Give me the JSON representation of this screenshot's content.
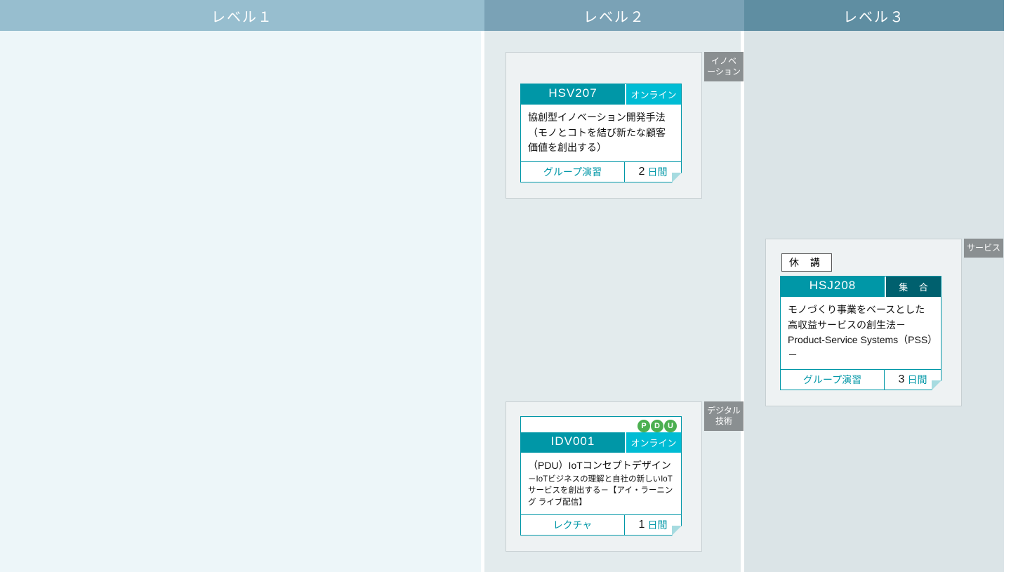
{
  "headers": {
    "l1": "レベル１",
    "l2": "レベル２",
    "l3": "レベル３"
  },
  "duration_unit": "日間",
  "blocks": {
    "innovation": {
      "tag": "イノベーション",
      "code": "HSV207",
      "mode": "オンライン",
      "title": "協創型イノベーション開発手法（モノとコトを結び新たな顧客価値を創出する）",
      "type": "グループ演習",
      "days": "2"
    },
    "digital": {
      "tag": "デジタル技術",
      "pdu": "PDU",
      "code": "IDV001",
      "mode": "オンライン",
      "title_main": "（PDU）IoTコンセプトデザイン",
      "title_sub": "－IoTビジネスの理解と自社の新しいIoTサービスを創出する－【アイ・ラーニング ライブ配信】",
      "type": "レクチャ",
      "days": "1"
    },
    "service": {
      "tag": "サービス",
      "status": "休 講",
      "code": "HSJ208",
      "mode": "集 合",
      "title": "モノづくり事業をベースとした高収益サービスの創生法－Product-Service Systems（PSS）－",
      "type": "グループ演習",
      "days": "3"
    }
  }
}
